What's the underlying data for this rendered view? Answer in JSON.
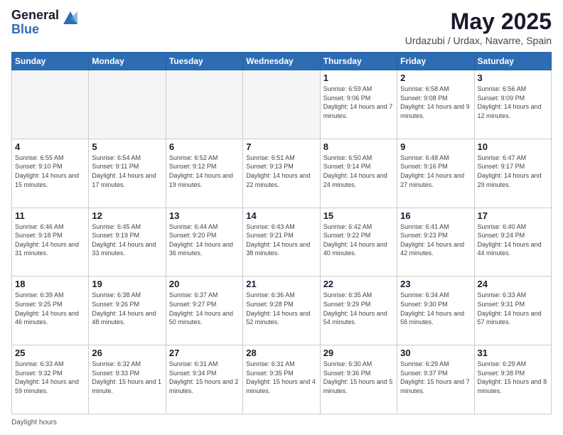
{
  "header": {
    "logo_general": "General",
    "logo_blue": "Blue",
    "title": "May 2025",
    "subtitle": "Urdazubi / Urdax, Navarre, Spain"
  },
  "days_of_week": [
    "Sunday",
    "Monday",
    "Tuesday",
    "Wednesday",
    "Thursday",
    "Friday",
    "Saturday"
  ],
  "weeks": [
    [
      {
        "day": "",
        "info": ""
      },
      {
        "day": "",
        "info": ""
      },
      {
        "day": "",
        "info": ""
      },
      {
        "day": "",
        "info": ""
      },
      {
        "day": "1",
        "info": "Sunrise: 6:59 AM\nSunset: 9:06 PM\nDaylight: 14 hours and 7 minutes."
      },
      {
        "day": "2",
        "info": "Sunrise: 6:58 AM\nSunset: 9:08 PM\nDaylight: 14 hours and 9 minutes."
      },
      {
        "day": "3",
        "info": "Sunrise: 6:56 AM\nSunset: 9:09 PM\nDaylight: 14 hours and 12 minutes."
      }
    ],
    [
      {
        "day": "4",
        "info": "Sunrise: 6:55 AM\nSunset: 9:10 PM\nDaylight: 14 hours and 15 minutes."
      },
      {
        "day": "5",
        "info": "Sunrise: 6:54 AM\nSunset: 9:11 PM\nDaylight: 14 hours and 17 minutes."
      },
      {
        "day": "6",
        "info": "Sunrise: 6:52 AM\nSunset: 9:12 PM\nDaylight: 14 hours and 19 minutes."
      },
      {
        "day": "7",
        "info": "Sunrise: 6:51 AM\nSunset: 9:13 PM\nDaylight: 14 hours and 22 minutes."
      },
      {
        "day": "8",
        "info": "Sunrise: 6:50 AM\nSunset: 9:14 PM\nDaylight: 14 hours and 24 minutes."
      },
      {
        "day": "9",
        "info": "Sunrise: 6:48 AM\nSunset: 9:16 PM\nDaylight: 14 hours and 27 minutes."
      },
      {
        "day": "10",
        "info": "Sunrise: 6:47 AM\nSunset: 9:17 PM\nDaylight: 14 hours and 29 minutes."
      }
    ],
    [
      {
        "day": "11",
        "info": "Sunrise: 6:46 AM\nSunset: 9:18 PM\nDaylight: 14 hours and 31 minutes."
      },
      {
        "day": "12",
        "info": "Sunrise: 6:45 AM\nSunset: 9:19 PM\nDaylight: 14 hours and 33 minutes."
      },
      {
        "day": "13",
        "info": "Sunrise: 6:44 AM\nSunset: 9:20 PM\nDaylight: 14 hours and 36 minutes."
      },
      {
        "day": "14",
        "info": "Sunrise: 6:43 AM\nSunset: 9:21 PM\nDaylight: 14 hours and 38 minutes."
      },
      {
        "day": "15",
        "info": "Sunrise: 6:42 AM\nSunset: 9:22 PM\nDaylight: 14 hours and 40 minutes."
      },
      {
        "day": "16",
        "info": "Sunrise: 6:41 AM\nSunset: 9:23 PM\nDaylight: 14 hours and 42 minutes."
      },
      {
        "day": "17",
        "info": "Sunrise: 6:40 AM\nSunset: 9:24 PM\nDaylight: 14 hours and 44 minutes."
      }
    ],
    [
      {
        "day": "18",
        "info": "Sunrise: 6:39 AM\nSunset: 9:25 PM\nDaylight: 14 hours and 46 minutes."
      },
      {
        "day": "19",
        "info": "Sunrise: 6:38 AM\nSunset: 9:26 PM\nDaylight: 14 hours and 48 minutes."
      },
      {
        "day": "20",
        "info": "Sunrise: 6:37 AM\nSunset: 9:27 PM\nDaylight: 14 hours and 50 minutes."
      },
      {
        "day": "21",
        "info": "Sunrise: 6:36 AM\nSunset: 9:28 PM\nDaylight: 14 hours and 52 minutes."
      },
      {
        "day": "22",
        "info": "Sunrise: 6:35 AM\nSunset: 9:29 PM\nDaylight: 14 hours and 54 minutes."
      },
      {
        "day": "23",
        "info": "Sunrise: 6:34 AM\nSunset: 9:30 PM\nDaylight: 14 hours and 56 minutes."
      },
      {
        "day": "24",
        "info": "Sunrise: 6:33 AM\nSunset: 9:31 PM\nDaylight: 14 hours and 57 minutes."
      }
    ],
    [
      {
        "day": "25",
        "info": "Sunrise: 6:33 AM\nSunset: 9:32 PM\nDaylight: 14 hours and 59 minutes."
      },
      {
        "day": "26",
        "info": "Sunrise: 6:32 AM\nSunset: 9:33 PM\nDaylight: 15 hours and 1 minute."
      },
      {
        "day": "27",
        "info": "Sunrise: 6:31 AM\nSunset: 9:34 PM\nDaylight: 15 hours and 2 minutes."
      },
      {
        "day": "28",
        "info": "Sunrise: 6:31 AM\nSunset: 9:35 PM\nDaylight: 15 hours and 4 minutes."
      },
      {
        "day": "29",
        "info": "Sunrise: 6:30 AM\nSunset: 9:36 PM\nDaylight: 15 hours and 5 minutes."
      },
      {
        "day": "30",
        "info": "Sunrise: 6:29 AM\nSunset: 9:37 PM\nDaylight: 15 hours and 7 minutes."
      },
      {
        "day": "31",
        "info": "Sunrise: 6:29 AM\nSunset: 9:38 PM\nDaylight: 15 hours and 8 minutes."
      }
    ]
  ],
  "footer": {
    "daylight_label": "Daylight hours"
  }
}
